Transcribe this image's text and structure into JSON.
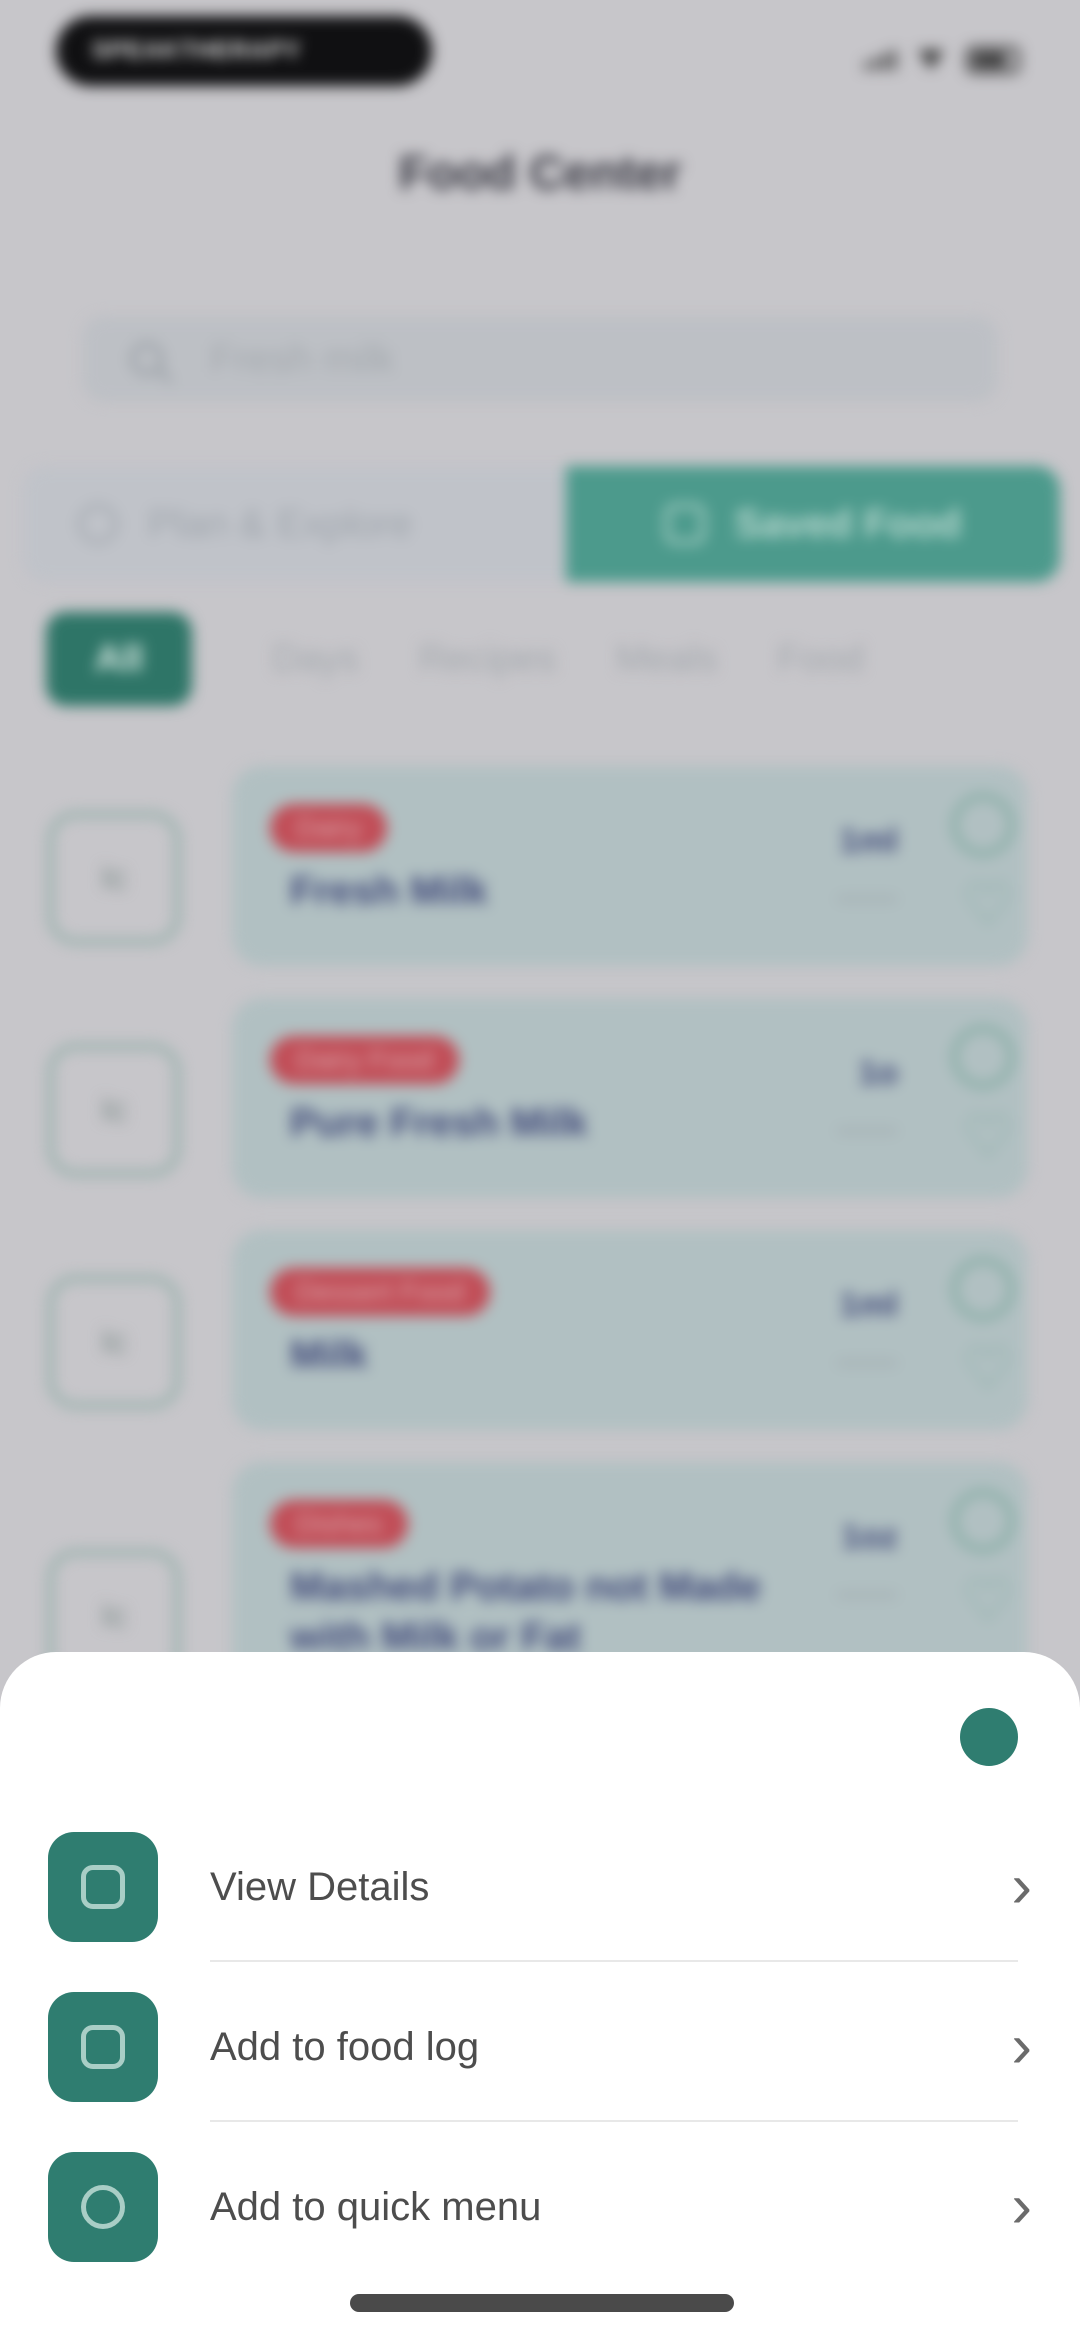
{
  "status_bar": {
    "island_text": "SPEAKTHERAPY"
  },
  "header": {
    "title": "Food Center"
  },
  "search": {
    "placeholder": "Fresh milk"
  },
  "segments": {
    "left": "Plan & Explore",
    "right": "Saved Food"
  },
  "filters": [
    "All",
    "Days",
    "Recipes",
    "Meals",
    "Food"
  ],
  "foods": [
    {
      "thumb": "Ic",
      "tag": "Dairy",
      "name": "Fresh Milk",
      "qty": "1ml"
    },
    {
      "thumb": "Ic",
      "tag": "Dairy Food",
      "name": "Pure Fresh Milk",
      "qty": "1o"
    },
    {
      "thumb": "Ic",
      "tag": "Dessert Food",
      "name": "Milk",
      "qty": "1ml"
    },
    {
      "thumb": "Ic",
      "tag": "Dishes",
      "name": "Mashed Potato not Made with Milk or Fat",
      "qty": "1oz"
    }
  ],
  "sheet": {
    "items": [
      {
        "label": "View Details",
        "icon": "details-icon"
      },
      {
        "label": "Add to food log",
        "icon": "food-log-icon"
      },
      {
        "label": "Add to quick menu",
        "icon": "quick-menu-icon"
      }
    ]
  },
  "colors": {
    "accent": "#2f7d70",
    "tag": "#c14d57"
  }
}
